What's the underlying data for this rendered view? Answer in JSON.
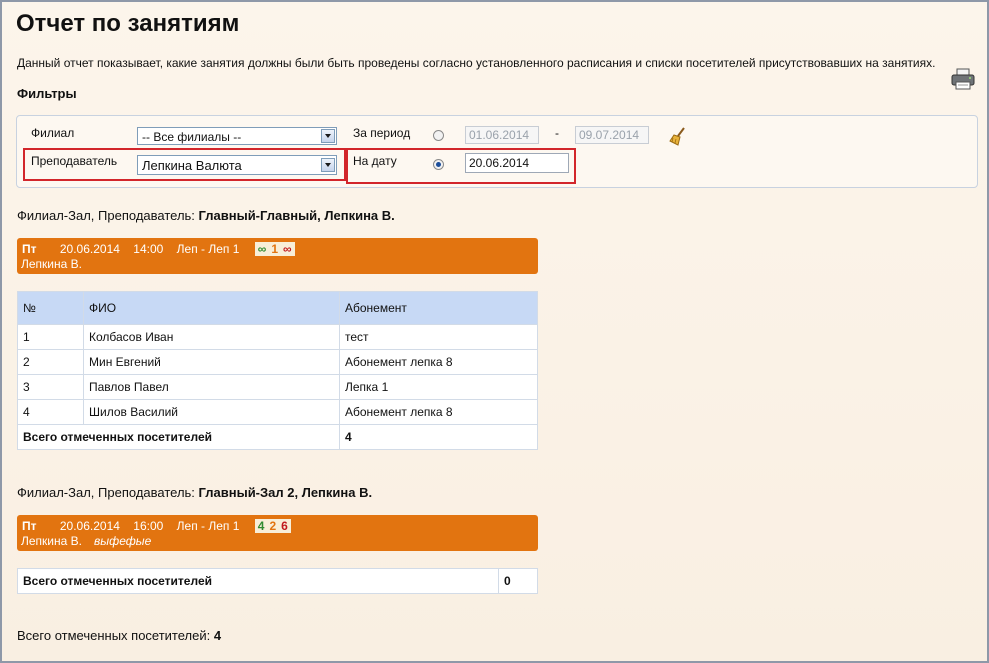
{
  "page": {
    "title": "Отчет по занятиям",
    "description": "Данный отчет показывает, какие занятия должны были быть проведены согласно установленного расписания и списки посетителей присутствовавших на занятиях.",
    "print_icon": "printer-icon"
  },
  "filters": {
    "title": "Фильтры",
    "branch_label": "Филиал",
    "branch_value": "-- Все филиалы --",
    "teacher_label": "Преподаватель",
    "teacher_value": "Лепкина Валюта",
    "period_label": "За период",
    "period_from": "01.06.2014",
    "period_dash": "-",
    "period_to": "09.07.2014",
    "date_label": "На дату",
    "date_value": "20.06.2014",
    "period_selected": false,
    "date_selected": true,
    "clear_icon": "broom-icon",
    "highlight_color": "#d2262b"
  },
  "groups": [
    {
      "prefix": "Филиал-Зал, Преподаватель: ",
      "name": "Главный-Главный, Лепкина В.",
      "lesson": {
        "day": "Пт",
        "date": "20.06.2014",
        "time": "14:00",
        "course": "Леп - Леп 1",
        "badge_a": "∞",
        "badge_b": "1",
        "badge_c": "∞",
        "teacher": "Лепкина В.",
        "note": ""
      },
      "table": {
        "headers": [
          "№",
          "ФИО",
          "Абонемент"
        ],
        "rows": [
          [
            "1",
            "Колбасов Иван",
            "тест"
          ],
          [
            "2",
            "Мин Евгений",
            "Абонемент лепка 8"
          ],
          [
            "3",
            "Павлов Павел",
            "Лепка 1"
          ],
          [
            "4",
            "Шилов Василий",
            "Абонемент лепка 8"
          ]
        ],
        "total_label": "Всего отмеченных посетителей",
        "total_value": "4"
      }
    },
    {
      "prefix": "Филиал-Зал, Преподаватель: ",
      "name": "Главный-Зал 2, Лепкина В.",
      "lesson": {
        "day": "Пт",
        "date": "20.06.2014",
        "time": "16:00",
        "course": "Леп - Леп 1",
        "badge_a": "4",
        "badge_b": "2",
        "badge_c": "6",
        "teacher": "Лепкина В.",
        "note": "выфефые"
      },
      "table": {
        "total_label": "Всего отмеченных посетителей",
        "total_value": "0"
      }
    }
  ],
  "summary": {
    "label": "Всего отмеченных посетителей: ",
    "value": "4"
  },
  "colors": {
    "lesson_bar": "#e27410",
    "table_header": "#c7d9f5",
    "background": "#fbf3e8"
  }
}
